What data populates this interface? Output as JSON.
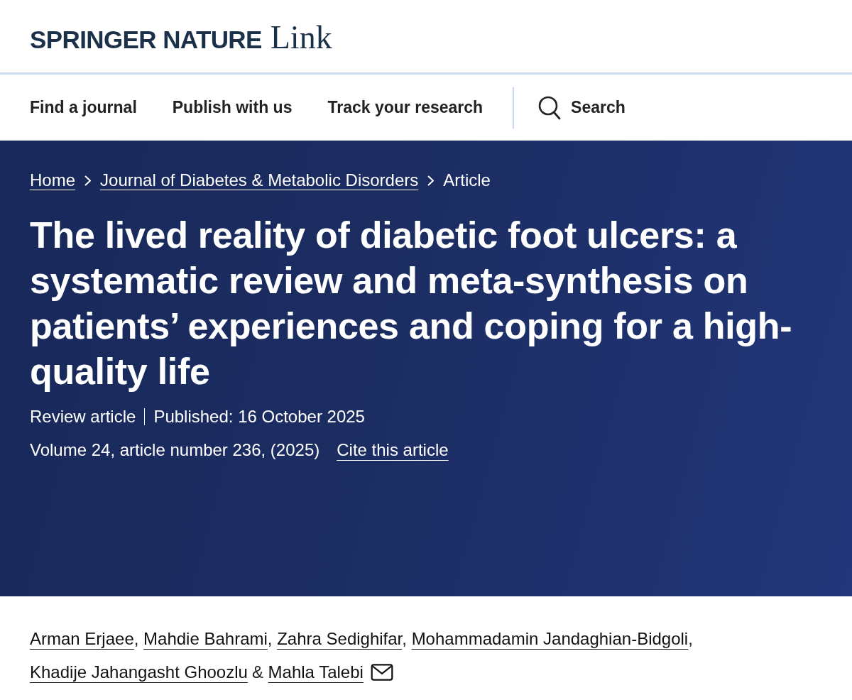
{
  "header": {
    "logo": {
      "brand": "SPRINGER NATURE",
      "product": "Link"
    }
  },
  "nav": {
    "items": [
      {
        "label": "Find a journal"
      },
      {
        "label": "Publish with us"
      },
      {
        "label": "Track your research"
      }
    ],
    "search": {
      "label": "Search"
    }
  },
  "hero": {
    "breadcrumbs": [
      {
        "label": "Home",
        "kind": "link"
      },
      {
        "label": "Journal of Diabetes & Metabolic Disorders",
        "kind": "link"
      },
      {
        "label": "Article",
        "kind": "current"
      }
    ],
    "title": "The lived reality of diabetic foot ulcers: a systematic review and meta-synthesis on patients’ experiences and coping for a high-quality life",
    "article_type": "Review article",
    "published": "Published: 16 October 2025",
    "citation": "Volume 24, article number 236, (2025)",
    "cite_link": "Cite this article"
  },
  "authors": [
    {
      "name": "Arman Erjaee",
      "separator": {
        "text": ",",
        "kind": "comma"
      },
      "corresponding": false
    },
    {
      "name": "Mahdie Bahrami",
      "separator": {
        "text": ",",
        "kind": "comma"
      },
      "corresponding": false
    },
    {
      "name": "Zahra Sedighifar",
      "separator": {
        "text": ",",
        "kind": "comma"
      },
      "corresponding": false
    },
    {
      "name": "Mohammadamin Jandaghian-Bidgoli",
      "separator": {
        "text": ",",
        "kind": "comma"
      },
      "corresponding": false
    },
    {
      "name": "Khadije Jahangasht Ghoozlu",
      "separator": {
        "text": "&",
        "kind": "conjunction"
      },
      "corresponding": false
    },
    {
      "name": "Mahla Talebi",
      "corresponding": true
    }
  ]
}
